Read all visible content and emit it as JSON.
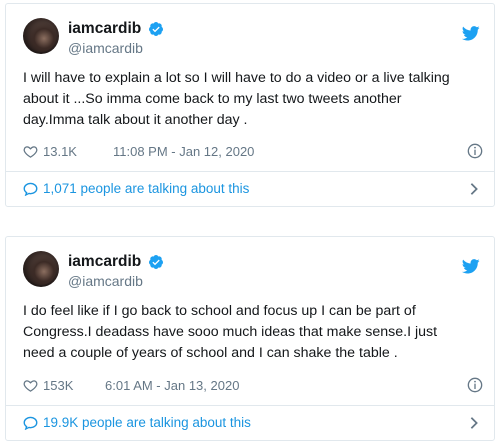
{
  "tweets": [
    {
      "name": "iamcardib",
      "handle": "@iamcardib",
      "text": "I will have to explain a lot so I will have to do a video or a live talking\nabout it ...So imma come back to my last two tweets another\nday.Imma talk about it another day .",
      "likes": "13.1K",
      "timestamp": "11:08 PM - Jan 12, 2020",
      "talking": "1,071 people are talking about this"
    },
    {
      "name": "iamcardib",
      "handle": "@iamcardib",
      "text": "I do feel like if I go back to school and focus up I can be  part of\nCongress.I deadass have sooo much ideas that make sense.I just\nneed a couple of years of school and I can  shake the table .",
      "likes": "153K",
      "timestamp": "6:01 AM - Jan 13, 2020",
      "talking": "19.9K people are talking about this"
    }
  ],
  "icons": {
    "bird": "twitter-bird-icon",
    "verified": "verified-badge-icon",
    "heart": "heart-icon",
    "info": "info-icon",
    "bubble": "speech-bubble-icon",
    "chevron": "chevron-right-icon"
  },
  "colors": {
    "accent": "#1da1f2",
    "link": "#1b95e0",
    "muted": "#657786",
    "border": "#e1e8ed"
  }
}
